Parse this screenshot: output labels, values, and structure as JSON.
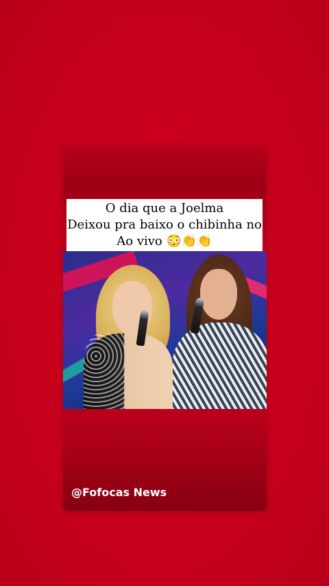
{
  "story": {
    "caption_lines": [
      "O dia que a Joelma",
      "Deixou pra baixo o chibinha no",
      "Ao vivo 😳👏👏"
    ],
    "watermark": "@Fofocas News"
  },
  "colors": {
    "background": "#c8001e",
    "card": "#c0001d",
    "caption_bg": "#ffffff",
    "caption_text": "#000000",
    "watermark_text": "#ffffff"
  },
  "video": {
    "description_icon": "video-still"
  }
}
